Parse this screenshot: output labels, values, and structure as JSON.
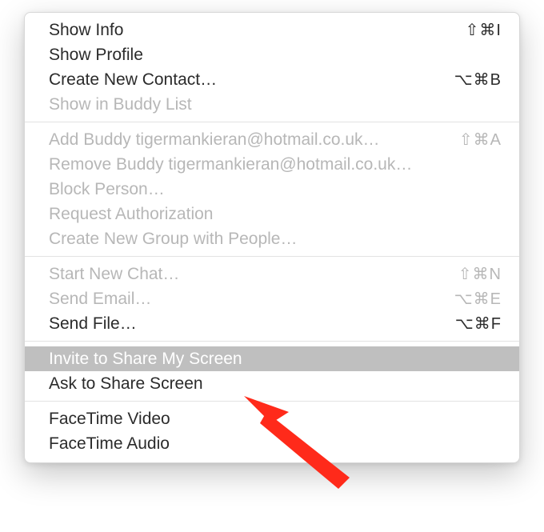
{
  "menu": {
    "groups": [
      [
        {
          "label": "Show Info",
          "shortcut": "⇧⌘I",
          "disabled": false
        },
        {
          "label": "Show Profile",
          "shortcut": "",
          "disabled": false
        },
        {
          "label": "Create New Contact…",
          "shortcut": "⌥⌘B",
          "disabled": false
        },
        {
          "label": "Show in Buddy List",
          "shortcut": "",
          "disabled": true
        }
      ],
      [
        {
          "label": "Add Buddy tigermankieran@hotmail.co.uk…",
          "shortcut": "⇧⌘A",
          "disabled": true
        },
        {
          "label": "Remove Buddy tigermankieran@hotmail.co.uk…",
          "shortcut": "",
          "disabled": true
        },
        {
          "label": "Block Person…",
          "shortcut": "",
          "disabled": true
        },
        {
          "label": "Request Authorization",
          "shortcut": "",
          "disabled": true
        },
        {
          "label": "Create New Group with People…",
          "shortcut": "",
          "disabled": true
        }
      ],
      [
        {
          "label": "Start New Chat…",
          "shortcut": "⇧⌘N",
          "disabled": true
        },
        {
          "label": "Send Email…",
          "shortcut": "⌥⌘E",
          "disabled": true
        },
        {
          "label": "Send File…",
          "shortcut": "⌥⌘F",
          "disabled": false
        }
      ],
      [
        {
          "label": "Invite to Share My Screen",
          "shortcut": "",
          "disabled": false,
          "highlight": true
        },
        {
          "label": "Ask to Share Screen",
          "shortcut": "",
          "disabled": false
        }
      ],
      [
        {
          "label": "FaceTime Video",
          "shortcut": "",
          "disabled": false
        },
        {
          "label": "FaceTime Audio",
          "shortcut": "",
          "disabled": false
        }
      ]
    ]
  },
  "annotation": {
    "arrow_color": "#ff2a1a"
  }
}
